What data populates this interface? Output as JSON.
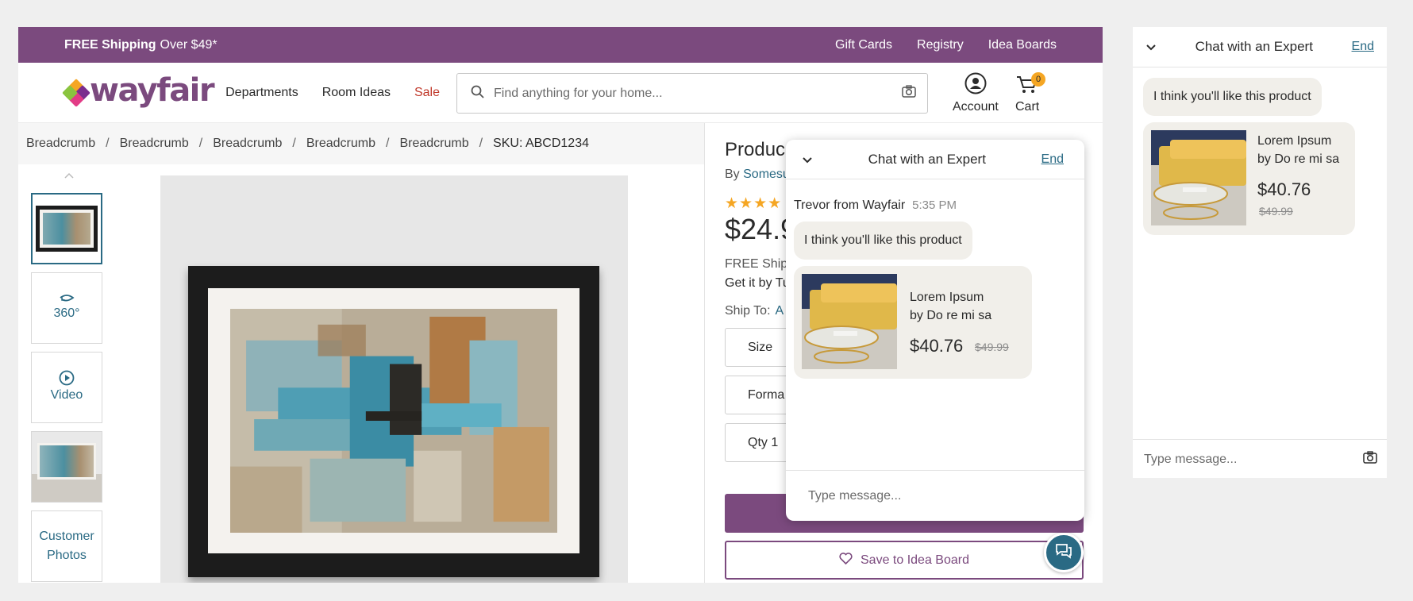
{
  "promo": {
    "free_shipping": "FREE Shipping",
    "threshold": "Over $49*",
    "links": [
      "Gift Cards",
      "Registry",
      "Idea Boards"
    ]
  },
  "header": {
    "logo": "wayfair",
    "nav": [
      "Departments",
      "Room Ideas",
      "Sale"
    ],
    "search_placeholder": "Find anything for your home...",
    "account": "Account",
    "cart": "Cart",
    "cart_count": "0"
  },
  "breadcrumb": {
    "items": [
      "Breadcrumb",
      "Breadcrumb",
      "Breadcrumb",
      "Breadcrumb",
      "Breadcrumb"
    ],
    "sku": "SKU: ABCD1234"
  },
  "gallery": {
    "thumbs": {
      "spin": "360°",
      "video": "Video",
      "customer_photos_line1": "Customer",
      "customer_photos_line2": "Photos"
    }
  },
  "product": {
    "title": "Produc",
    "by": "By",
    "brand": "Somesu",
    "rating_stars": 4,
    "price": "$24.9",
    "shipping": "FREE Shipp",
    "delivery": "Get it by Tu",
    "ship_to_label": "Ship To:",
    "ship_to_value": "A",
    "size_label": "Size",
    "format_label": "Forma",
    "qty_label": "Qty 1",
    "save_label": "Save to Idea Board"
  },
  "chat_popup": {
    "title": "Chat with an Expert",
    "end": "End",
    "sender": "Trevor from Wayfair",
    "time": "5:35 PM",
    "message": "I think you'll like this product",
    "card": {
      "name": "Lorem Ipsum",
      "by": "by Do re mi sa",
      "price": "$40.76",
      "was": "$49.99"
    },
    "input_placeholder": "Type message..."
  },
  "side_chat": {
    "title": "Chat with an Expert",
    "end": "End",
    "message": "I think you'll like this product",
    "card": {
      "name": "Lorem Ipsum",
      "by_line1": "by Do re mi sa",
      "price": "$40.76",
      "was": "$49.99"
    },
    "input_placeholder": "Type message..."
  },
  "colors": {
    "brand_purple": "#7b4a7e",
    "link_teal": "#2a6a84",
    "sale_red": "#c0392b",
    "star": "#f5a623"
  },
  "icons": [
    "search-icon",
    "camera-icon",
    "account-icon",
    "cart-icon",
    "rotate-360-icon",
    "play-icon",
    "chevron-down-icon",
    "heart-icon",
    "chat-bubbles-icon"
  ]
}
